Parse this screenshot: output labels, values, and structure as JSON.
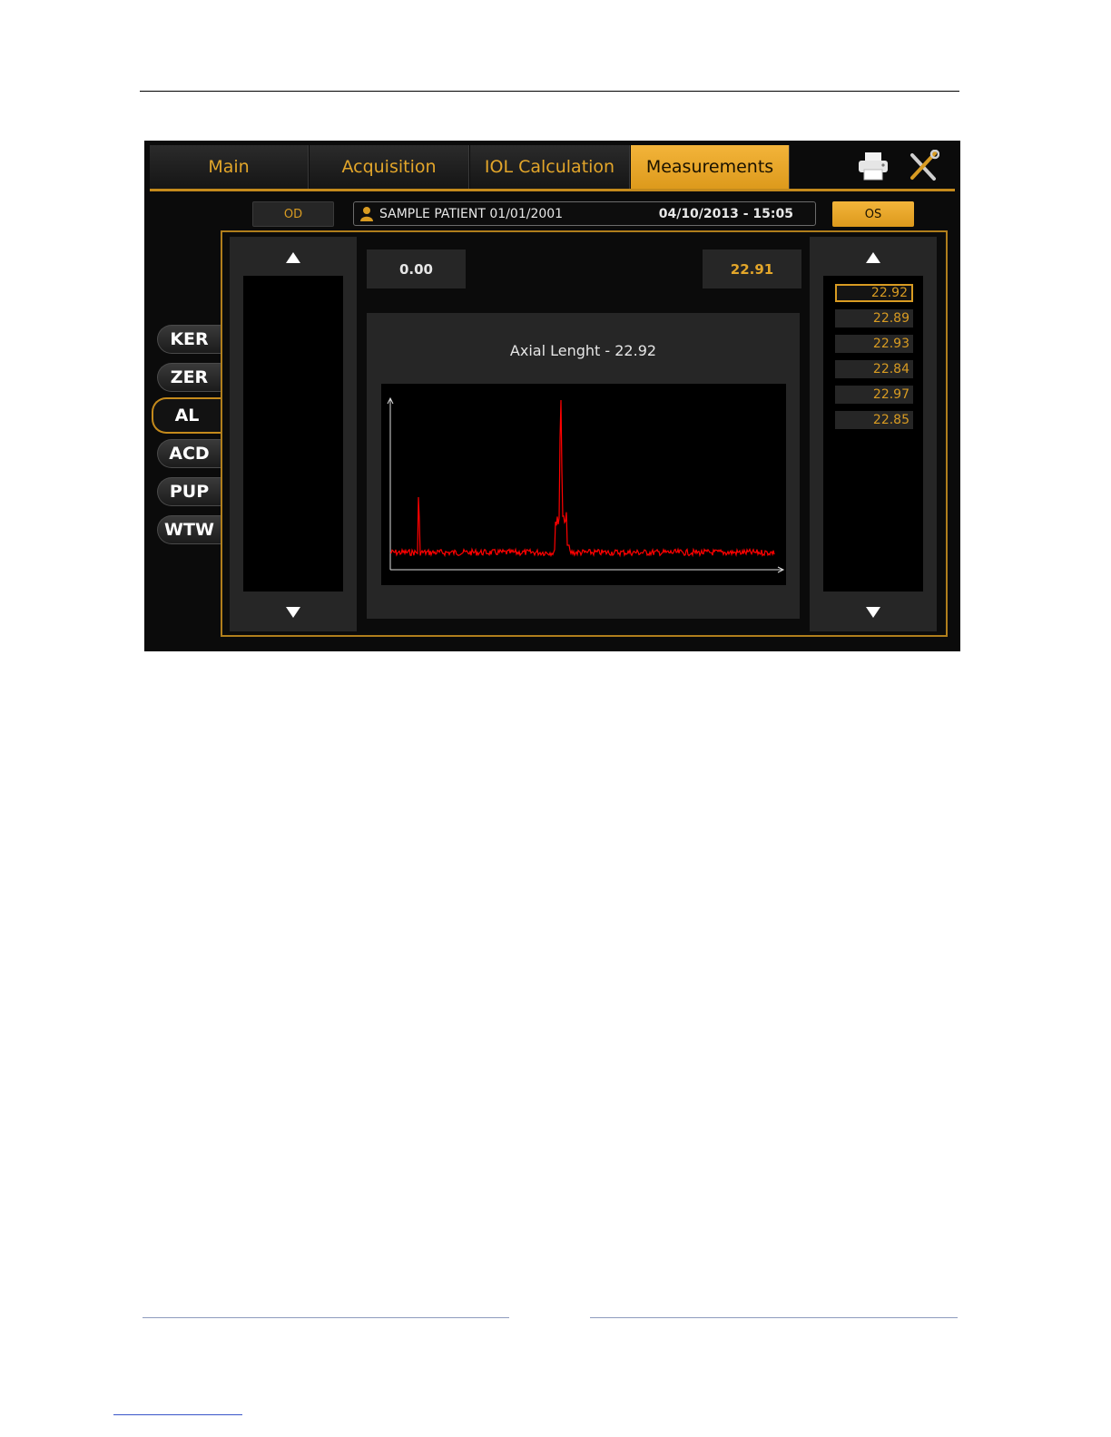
{
  "tabs": [
    "Main",
    "Acquisition",
    "IOL Calculation",
    "Measurements"
  ],
  "active_tab": "Measurements",
  "toolbar": {
    "print_icon": "printer-icon",
    "settings_icon": "tools-icon"
  },
  "eyes": {
    "left_label": "OD",
    "right_label": "OS",
    "active": "OS"
  },
  "patient": {
    "name": "SAMPLE PATIENT 01/01/2001",
    "datetime": "04/10/2013 - 15:05"
  },
  "side_tabs": [
    "KER",
    "ZER",
    "AL",
    "ACD",
    "PUP",
    "WTW"
  ],
  "active_side_tab": "AL",
  "values": {
    "left": "0.00",
    "right": "22.91"
  },
  "graph": {
    "title": "Axial Lenght - 22.92",
    "line_color": "#ff0000"
  },
  "readings": [
    "22.92",
    "22.89",
    "22.93",
    "22.84",
    "22.97",
    "22.85"
  ],
  "selected_reading": "22.92",
  "colors": {
    "accent": "#e3a62a",
    "active_bg": "#f0b033",
    "panel": "#262626"
  }
}
